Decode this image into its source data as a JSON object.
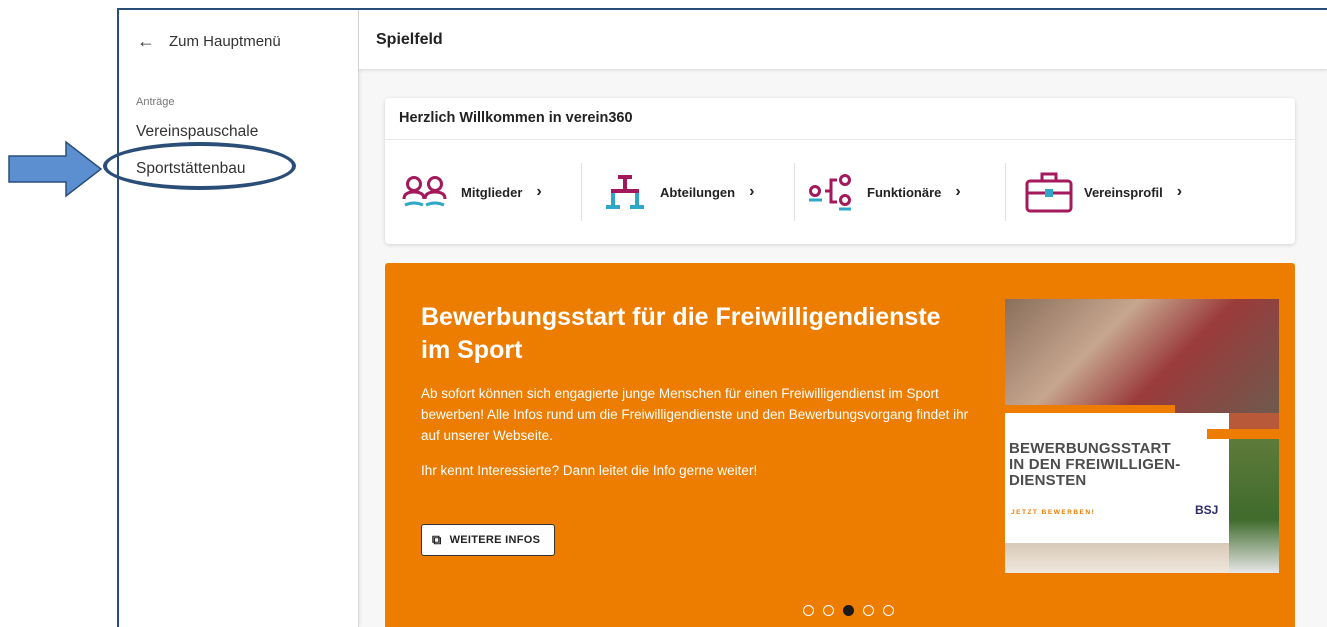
{
  "sidebar": {
    "back_label": "Zum Hauptmenü",
    "section_label": "Anträge",
    "items": [
      {
        "label": "Vereinspauschale"
      },
      {
        "label": "Sportstättenbau"
      }
    ]
  },
  "header": {
    "title": "Spielfeld"
  },
  "welcome": {
    "title": "Herzlich Willkommen in verein360",
    "tiles": [
      {
        "label": "Mitglieder",
        "icon": "members-icon"
      },
      {
        "label": "Abteilungen",
        "icon": "departments-icon"
      },
      {
        "label": "Funktionäre",
        "icon": "officials-icon"
      },
      {
        "label": "Vereinsprofil",
        "icon": "briefcase-icon"
      }
    ]
  },
  "banner": {
    "headline": "Bewerbungsstart für die Freiwilligendienste im Sport",
    "paragraph1": "Ab sofort können sich engagierte junge Menschen für einen Freiwilligendienst im Sport bewerben! Alle Infos rund um die Freiwilligendienste und den Bewerbungsvorgang findet ihr auf unserer Webseite.",
    "paragraph2": "Ihr kennt Interessierte? Dann leitet die Info gerne weiter!",
    "button_label": "WEITERE INFOS",
    "promo_image": {
      "line1": "BEWERBUNGSSTART",
      "line2": "IN DEN FREIWILLIGEN-",
      "line3": "DIENSTEN",
      "cta": "JETZT BEWERBEN!",
      "logo": "BSJ"
    },
    "carousel": {
      "total": 5,
      "active_index": 2
    }
  },
  "colors": {
    "accent_orange": "#ec7d00",
    "icon_magenta": "#a3195b",
    "icon_teal": "#2fa8c8",
    "annotation_blue": "#5b8fd0",
    "annotation_navy": "#2b4e78"
  }
}
